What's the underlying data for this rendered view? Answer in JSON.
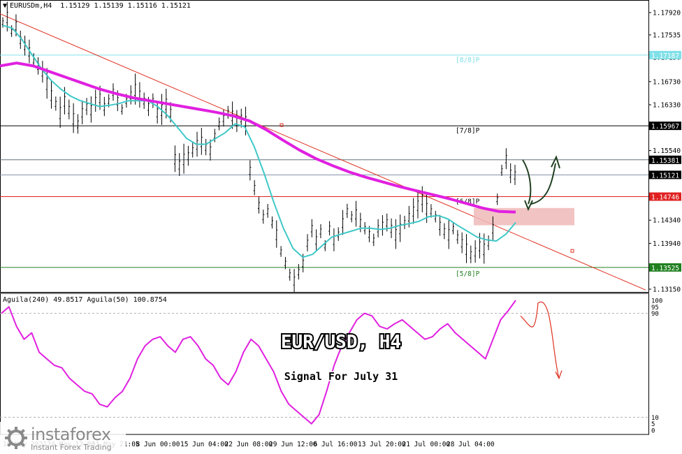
{
  "header": {
    "symbol": "EURUSDm,H4",
    "ohlc": "1.15129 1.15139 1.15116 1.15121"
  },
  "indicator_header": {
    "text": "Aguila(240) 49.8517  Aguila(50) 100.8754"
  },
  "overlay": {
    "title": "EUR/USD, H4",
    "subtitle": "Signal For July 31"
  },
  "logo": {
    "name": "instaforex",
    "tagline": "Instant Forex Trading"
  },
  "colors": {
    "price_bars": "#000000",
    "ma_fast": "#40c8c8",
    "ma_slow": "#e020e0",
    "trendline": "#e03020",
    "level_8_8": "#80e0e8",
    "level_7_8": "#000000",
    "level_6_8": "#e02020",
    "level_5_8": "#208020",
    "oscillator": "#e020e0",
    "zone": "#f0b8b8",
    "arrow_up": "#204020",
    "arrow_down": "#e03020"
  },
  "chart_data": [
    {
      "type": "line",
      "name": "EURUSD H4 price chart",
      "ylim": [
        1.1315,
        1.1792
      ],
      "y_ticks": [
        "1.17920",
        "1.17535",
        "1.17150",
        "1.16730",
        "1.16330",
        "1.15540",
        "1.14340",
        "1.13940",
        "1.13150"
      ],
      "x_ticks": [
        "19 May 2021",
        "24 May 12:00",
        "31 May 21:05",
        "8 Jun 00:00",
        "15 Jun 04:00",
        "22 Jun 08:00",
        "29 Jun 12:00",
        "6 Jul 16:00",
        "13 Jul 20:00",
        "21 Jul 00:00",
        "28 Jul 04:00"
      ],
      "levels": [
        {
          "label": "[8/8]P",
          "price": 1.17187,
          "tag": "1.17187",
          "style": "cyan"
        },
        {
          "label": "[7/8]P",
          "price": 1.15967,
          "tag": "1.15967",
          "style": "black"
        },
        {
          "label": "",
          "price": 1.15381,
          "tag": "1.15381",
          "style": "gray"
        },
        {
          "label": "",
          "price": 1.15121,
          "tag": "1.15121",
          "style": "current"
        },
        {
          "label": "[6/8]P",
          "price": 1.14746,
          "tag": "1.14746",
          "style": "red"
        },
        {
          "label": "[5/8]P",
          "price": 1.13525,
          "tag": "1.13525",
          "style": "green"
        }
      ],
      "series": [
        {
          "kind": "price_bars",
          "values": [
            1.1775,
            1.1785,
            1.176,
            1.177,
            1.1745,
            1.1735,
            1.1725,
            1.171,
            1.17,
            1.169,
            1.167,
            1.165,
            1.1635,
            1.162,
            1.164,
            1.1625,
            1.161,
            1.16,
            1.162,
            1.163,
            1.1625,
            1.164,
            1.1645,
            1.163,
            1.164,
            1.1655,
            1.164,
            1.1625,
            1.164,
            1.165,
            1.166,
            1.165,
            1.164,
            1.163,
            1.164,
            1.162,
            1.1625,
            1.1635,
            1.162,
            1.154,
            1.153,
            1.154,
            1.1545,
            1.1555,
            1.1565,
            1.157,
            1.156,
            1.1555,
            1.158,
            1.16,
            1.161,
            1.162,
            1.1615,
            1.1605,
            1.161,
            1.1605,
            1.152,
            1.149,
            1.146,
            1.144,
            1.145,
            1.143,
            1.141,
            1.138,
            1.136,
            1.134,
            1.133,
            1.1345,
            1.136,
            1.1395,
            1.142,
            1.14,
            1.1415,
            1.139,
            1.142,
            1.14,
            1.141,
            1.143,
            1.145,
            1.144,
            1.1445,
            1.143,
            1.142,
            1.141,
            1.14,
            1.142,
            1.1425,
            1.143,
            1.142,
            1.141,
            1.142,
            1.143,
            1.144,
            1.145,
            1.146,
            1.147,
            1.1455,
            1.145,
            1.144,
            1.1425,
            1.1415,
            1.141,
            1.142,
            1.1405,
            1.1395,
            1.1385,
            1.1375,
            1.138,
            1.139,
            1.1385,
            1.1395,
            1.142,
            1.147,
            1.152,
            1.154,
            1.1515,
            1.1512
          ]
        },
        {
          "kind": "ma_fast",
          "values": [
            1.177,
            1.1765,
            1.1745,
            1.172,
            1.1695,
            1.1675,
            1.166,
            1.1648,
            1.164,
            1.1635,
            1.163,
            1.1632,
            1.1635,
            1.164,
            1.164,
            1.164,
            1.163,
            1.1615,
            1.1595,
            1.1575,
            1.1565,
            1.1565,
            1.1575,
            1.1585,
            1.16,
            1.1595,
            1.156,
            1.1515,
            1.1465,
            1.142,
            1.1385,
            1.137,
            1.1375,
            1.139,
            1.1405,
            1.141,
            1.1415,
            1.142,
            1.142,
            1.1418,
            1.142,
            1.1425,
            1.1428,
            1.1432,
            1.144,
            1.1442,
            1.1436,
            1.1425,
            1.1415,
            1.1405,
            1.14,
            1.1398,
            1.141,
            1.143
          ]
        },
        {
          "kind": "ma_slow",
          "values": [
            1.17,
            1.1705,
            1.17,
            1.169,
            1.168,
            1.167,
            1.166,
            1.1652,
            1.1645,
            1.164,
            1.1635,
            1.163,
            1.1625,
            1.162,
            1.1614,
            1.1605,
            1.159,
            1.1572,
            1.1555,
            1.154,
            1.1528,
            1.1517,
            1.1508,
            1.15,
            1.1492,
            1.1485,
            1.1478,
            1.1471,
            1.1463,
            1.1455,
            1.1449,
            1.1448
          ]
        }
      ]
    },
    {
      "type": "line",
      "name": "Aguila oscillator",
      "ylim": [
        0,
        100
      ],
      "y_ticks": [
        "100",
        "95",
        "90",
        "10",
        "5",
        "0"
      ],
      "series": [
        {
          "name": "Aguila(240)",
          "value": 49.8517
        },
        {
          "name": "Aguila(50)",
          "value": 100.8754,
          "values": [
            90,
            95,
            80,
            70,
            75,
            60,
            55,
            50,
            48,
            40,
            35,
            30,
            28,
            20,
            18,
            25,
            30,
            40,
            55,
            65,
            70,
            72,
            65,
            60,
            70,
            72,
            65,
            55,
            50,
            40,
            35,
            45,
            60,
            70,
            65,
            55,
            45,
            30,
            20,
            15,
            10,
            5,
            12,
            30,
            50,
            65,
            75,
            85,
            90,
            88,
            80,
            78,
            82,
            85,
            80,
            75,
            70,
            72,
            78,
            82,
            75,
            70,
            65,
            60,
            55,
            70,
            85,
            92,
            100
          ]
        }
      ]
    }
  ]
}
